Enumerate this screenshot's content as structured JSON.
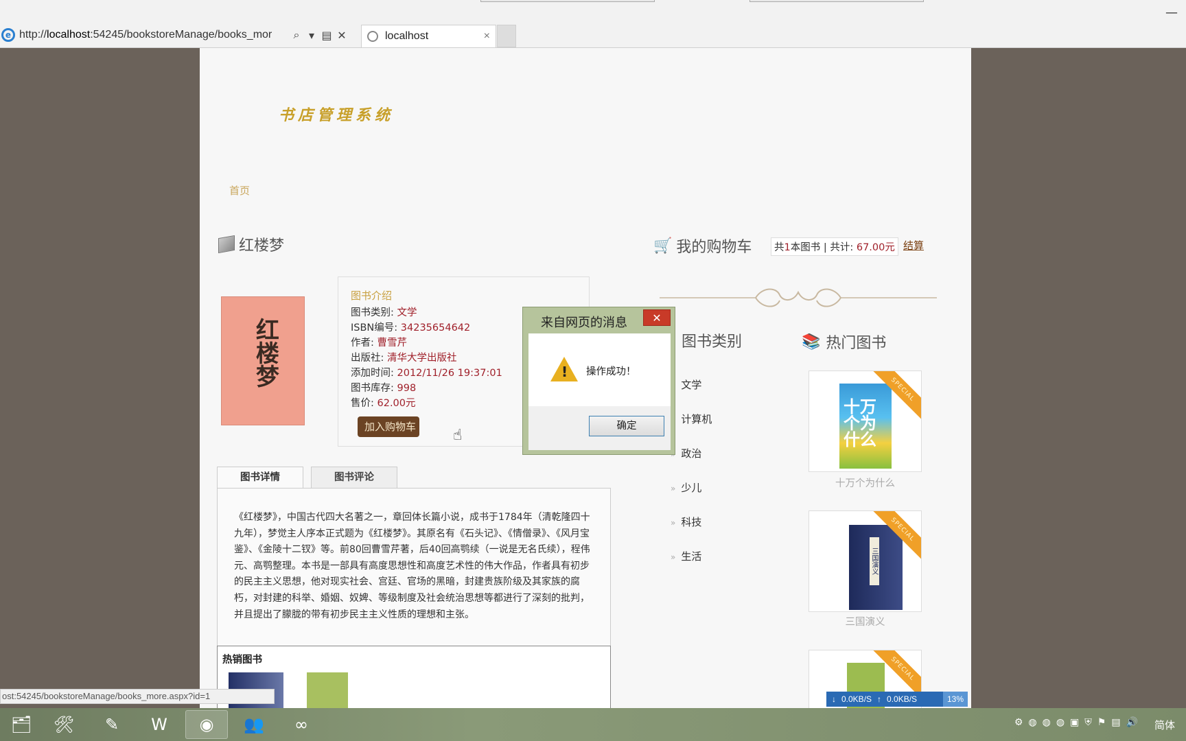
{
  "browser": {
    "url_prefix": "http://",
    "url_host": "localhost",
    "url_rest": ":54245/bookstoreManage/books_mor",
    "tab_title": "localhost",
    "status_url": "ost:54245/bookstoreManage/books_more.aspx?id=1"
  },
  "site": {
    "logo": "书店管理系统",
    "nav_home": "首页"
  },
  "book": {
    "title": "红楼梦",
    "cover_text": "红楼梦",
    "intro_heading": "图书介绍",
    "fields": [
      {
        "label": "图书类别: ",
        "value": "文学"
      },
      {
        "label": "ISBN编号: ",
        "value": "34235654642"
      },
      {
        "label": "作者: ",
        "value": "曹雪芹"
      },
      {
        "label": "出版社: ",
        "value": "清华大学出版社"
      },
      {
        "label": "添加时间: ",
        "value": "2012/11/26 19:37:01"
      },
      {
        "label": "图书库存: ",
        "value": "998"
      },
      {
        "label": "售价: ",
        "value": "62.00元"
      }
    ],
    "add_to_cart": "加入购物车"
  },
  "tabs": [
    "图书详情",
    "图书评论"
  ],
  "description": "《红楼梦》，中国古代四大名著之一，章回体长篇小说，成书于1784年（清乾隆四十九年），梦觉主人序本正式题为《红楼梦》。其原名有《石头记》、《情僧录》、《风月宝鉴》、《金陵十二钗》等。前80回曹雪芹著，后40回高鹗续（一说是无名氏续），程伟元、高鹗整理。本书是一部具有高度思想性和高度艺术性的伟大作品，作者具有初步的民主主义思想，他对现实社会、宫廷、官场的黑暗，封建贵族阶级及其家族的腐朽，对封建的科举、婚姻、奴婢、等级制度及社会统治思想等都进行了深刻的批判，并且提出了朦胧的带有初步民主主义性质的理想和主张。",
  "hot_sale_title": "热销图书",
  "cart": {
    "title": "我的购物车",
    "summary_prefix": "共",
    "count": "1",
    "summary_mid": "本图书 | 共计: ",
    "total": "67.00元",
    "checkout": "结算"
  },
  "categories": {
    "title": "图书类别",
    "items": [
      "文学",
      "计算机",
      "政治",
      "少儿",
      "科技",
      "生活"
    ]
  },
  "hot_books": {
    "title": "热门图书",
    "ribbon": "SPECIAL",
    "items": [
      "十万个为什么",
      "三国演义"
    ],
    "cover_texts": [
      "十万个为什么",
      "三国演义"
    ]
  },
  "dialog": {
    "title": "来自网页的消息",
    "message": "操作成功！",
    "ok": "确定",
    "close": "✕"
  },
  "speed": {
    "down": "0.0KB/S",
    "up": "0.0KB/S",
    "pct": "13%"
  },
  "taskbar": {
    "ime": "简体"
  }
}
